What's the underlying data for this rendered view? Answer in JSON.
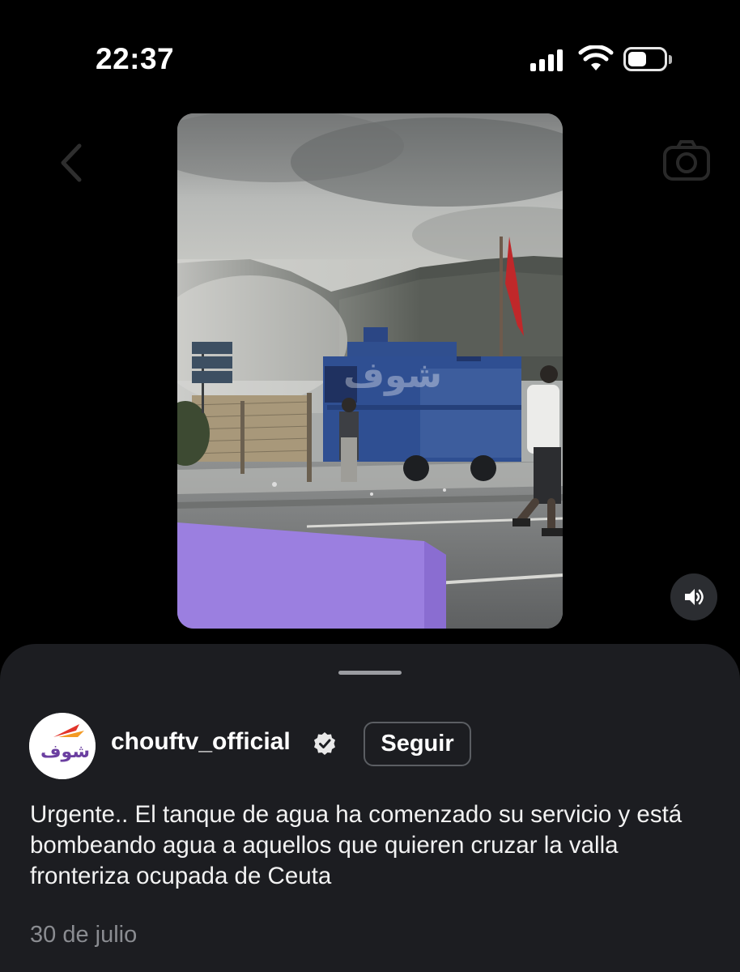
{
  "status_bar": {
    "time": "22:37",
    "icons": [
      "cellular-signal-icon",
      "wifi-icon",
      "battery-icon"
    ]
  },
  "background_controls": {
    "icons": [
      "back-chevron-icon",
      "camera-icon"
    ]
  },
  "media": {
    "watermark_text": "شوف",
    "sound_icon": "speaker-icon"
  },
  "post": {
    "avatar_icon": "chouftv-logo-icon",
    "avatar_text": "شوف TV",
    "username": "chouftv_official",
    "verified_icon": "verified-badge-icon",
    "follow_label": "Seguir",
    "caption": "Urgente.. El tanque de agua ha comenzado su servicio y está bombeando agua a aquellos que quieren cruzar la valla fronteriza ocupada de Ceuta",
    "date": "30 de julio"
  },
  "colors": {
    "background": "#000000",
    "sheet": "#1c1d21",
    "secondary_text": "#8a8c91",
    "sticker_purple": "#9b7fe0",
    "truck_blue": "#2f4f92",
    "flag_red": "#c0282a"
  }
}
